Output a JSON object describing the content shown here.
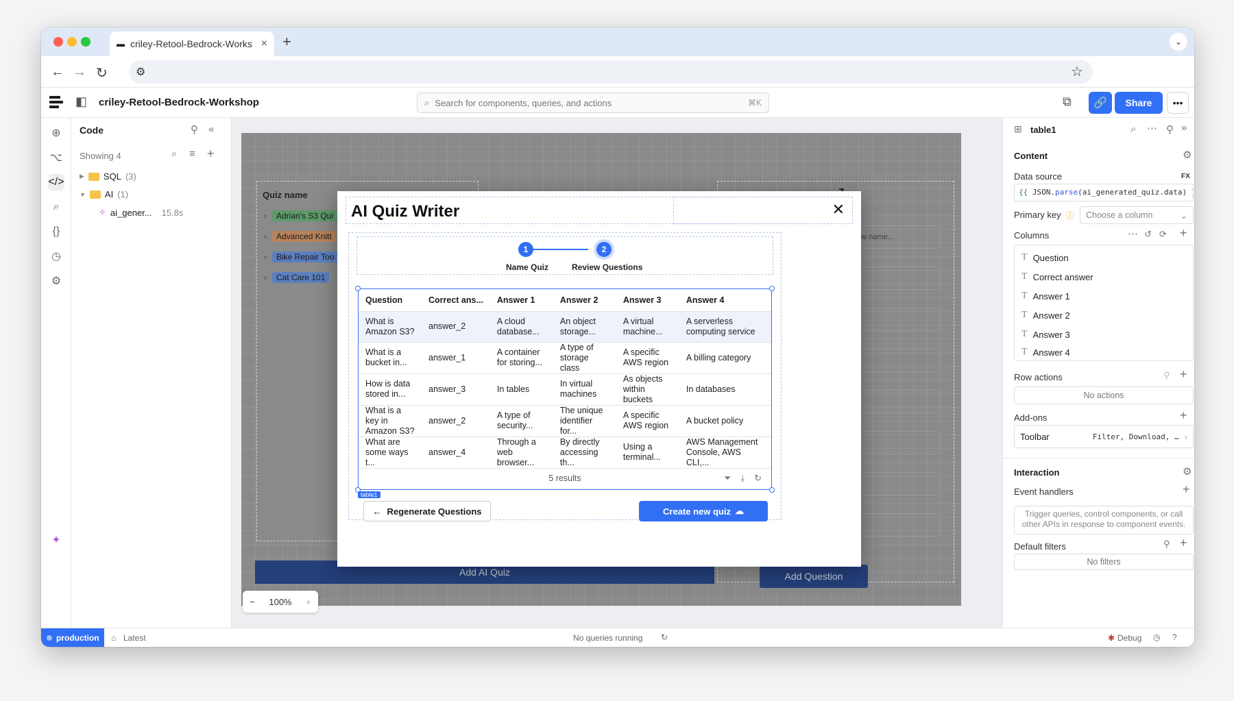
{
  "browser": {
    "tab_title": "criley-Retool-Bedrock-Works",
    "tab_close": "×",
    "new_tab": "+"
  },
  "header": {
    "app_title": "criley-Retool-Bedrock-Workshop",
    "search_placeholder": "Search for components, queries, and actions",
    "search_shortcut": "⌘K",
    "share_label": "Share"
  },
  "code_panel": {
    "title": "Code",
    "showing": "Showing 4",
    "folders": [
      {
        "name": "SQL",
        "count": "(3)"
      },
      {
        "name": "AI",
        "count": "(1)"
      }
    ],
    "query": {
      "name": "ai_gener...",
      "time": "15.8s"
    }
  },
  "app": {
    "quiz_list_header": "Quiz name",
    "quizzes": [
      {
        "name": "Adrian's S3 Qui",
        "color": "#5c9a6a"
      },
      {
        "name": "Advanced Knitt",
        "color": "#b8835b"
      },
      {
        "name": "Bike Repair Too",
        "color": "#5b7fbf"
      },
      {
        "name": "Cat Care 101",
        "color": "#5b7fbf"
      }
    ],
    "add_ai_quiz": "Add AI Quiz",
    "add_question": "Add Question",
    "right_title_fragment": "z",
    "new_name_placeholder": "ew name...",
    "zoom": "100%"
  },
  "modal": {
    "title": "AI Quiz Writer",
    "steps": [
      {
        "num": "1",
        "label": "Name Quiz"
      },
      {
        "num": "2",
        "label": "Review Questions"
      }
    ],
    "columns": [
      "Question",
      "Correct ans...",
      "Answer 1",
      "Answer 2",
      "Answer 3",
      "Answer 4"
    ],
    "rows": [
      [
        "What is Amazon S3?",
        "answer_2",
        "A cloud database...",
        "An object storage...",
        "A virtual machine...",
        "A serverless computing service"
      ],
      [
        "What is a bucket in...",
        "answer_1",
        "A container for storing...",
        "A type of storage class",
        "A specific AWS region",
        "A billing category"
      ],
      [
        "How is data stored in...",
        "answer_3",
        "In tables",
        "In virtual machines",
        "As objects within buckets",
        "In databases"
      ],
      [
        "What is a key in Amazon S3?",
        "answer_2",
        "A type of security...",
        "The unique identifier for...",
        "A specific AWS region",
        "A bucket policy"
      ],
      [
        "What are some ways t...",
        "answer_4",
        "Through a web browser...",
        "By directly accessing th...",
        "Using a terminal...",
        "AWS Management Console, AWS CLI,..."
      ]
    ],
    "results": "5 results",
    "component_tag": "table1",
    "regen_label": "Regenerate Questions",
    "create_label": "Create new quiz"
  },
  "inspector": {
    "component": "table1",
    "content_section": "Content",
    "data_source_label": "Data source",
    "fx": "FX",
    "ds_open": "{{",
    "ds_expr1": " JSON.",
    "ds_method": "parse",
    "ds_expr2": "(ai_generated_quiz.data) ",
    "ds_close": "}}",
    "primary_key_label": "Primary key",
    "primary_key_placeholder": "Choose a column",
    "columns_label": "Columns",
    "columns": [
      "Question",
      "Correct answer",
      "Answer 1",
      "Answer 2",
      "Answer 3",
      "Answer 4"
    ],
    "row_actions_label": "Row actions",
    "no_actions": "No actions",
    "addons_label": "Add-ons",
    "toolbar_label": "Toolbar",
    "toolbar_value": "Filter, Download, …",
    "interaction_section": "Interaction",
    "event_handlers_label": "Event handlers",
    "event_handlers_hint": "Trigger queries, control components, or call other APIs in response to component events.",
    "default_filters_label": "Default filters",
    "no_filters": "No filters"
  },
  "status": {
    "env": "production",
    "version": "Latest",
    "queries": "No queries running",
    "debug": "Debug"
  },
  "colors": {
    "accent": "#3170f5",
    "dark_button": "#24407b"
  }
}
